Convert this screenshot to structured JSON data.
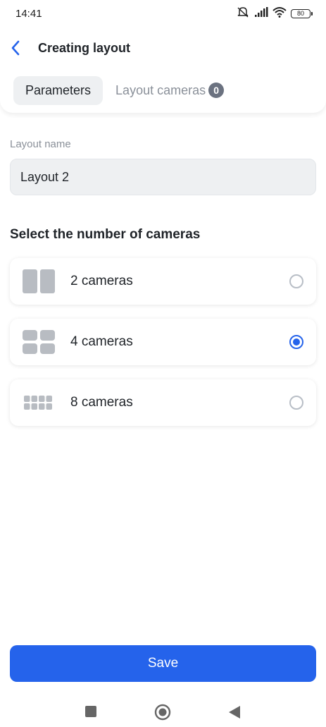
{
  "status_bar": {
    "time": "14:41",
    "battery": "80",
    "icons": [
      "muted-bell-icon",
      "signal-icon",
      "wifi-icon",
      "battery-icon"
    ]
  },
  "header": {
    "title": "Creating layout",
    "back_icon": "chevron-left-icon"
  },
  "tabs": {
    "parameters": "Parameters",
    "layout_cameras": "Layout cameras",
    "layout_cameras_count": "0"
  },
  "layout_name": {
    "label": "Layout name",
    "value": "Layout 2"
  },
  "camera_section": {
    "title": "Select the number of cameras",
    "options": [
      {
        "label": "2 cameras",
        "icon": "grid-2-icon",
        "selected": false
      },
      {
        "label": "4 cameras",
        "icon": "grid-4-icon",
        "selected": true
      },
      {
        "label": "8 cameras",
        "icon": "grid-8-icon",
        "selected": false
      }
    ]
  },
  "save_button": "Save",
  "colors": {
    "accent": "#2563eb",
    "field_bg": "#eef0f2",
    "muted_text": "#8a9099",
    "icon_gray": "#b8bcc2"
  },
  "system_nav": [
    "recents-square-icon",
    "home-circle-icon",
    "back-triangle-icon"
  ]
}
